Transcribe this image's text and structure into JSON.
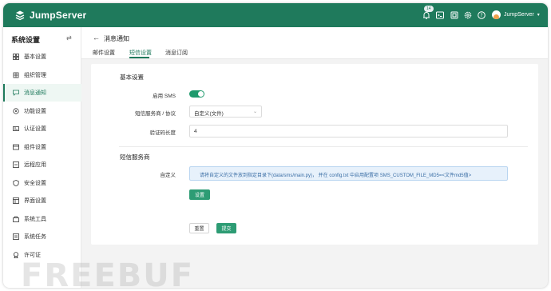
{
  "header": {
    "brand": "JumpServer",
    "notification_count": "14",
    "user_name": "JumpServer",
    "colors": {
      "bar": "#1f7a5c",
      "accent": "#2d9c74"
    }
  },
  "sidebar": {
    "title": "系统设置",
    "items": [
      {
        "label": "基本设置",
        "icon": "grid-icon"
      },
      {
        "label": "组织管理",
        "icon": "org-icon"
      },
      {
        "label": "消息通知",
        "icon": "message-icon",
        "active": true
      },
      {
        "label": "功能设置",
        "icon": "function-icon"
      },
      {
        "label": "认证设置",
        "icon": "auth-icon"
      },
      {
        "label": "组件设置",
        "icon": "component-icon"
      },
      {
        "label": "远程应用",
        "icon": "remote-app-icon"
      },
      {
        "label": "安全设置",
        "icon": "shield-icon"
      },
      {
        "label": "界面设置",
        "icon": "interface-icon"
      },
      {
        "label": "系统工具",
        "icon": "toolbox-icon"
      },
      {
        "label": "系统任务",
        "icon": "task-icon"
      },
      {
        "label": "许可证",
        "icon": "license-icon"
      }
    ]
  },
  "page": {
    "title": "消息通知",
    "tabs": [
      "邮件设置",
      "短信设置",
      "消息订阅"
    ],
    "active_tab": "短信设置"
  },
  "form": {
    "section_basic": "基本设置",
    "enable_sms_label": "启用 SMS",
    "enable_sms": true,
    "provider_label": "短信服务商 / 协议",
    "provider_value": "自定义(文件)",
    "code_length_label": "验证码长度",
    "code_length_value": "4",
    "section_provider": "短信服务商",
    "custom_label": "自定义",
    "custom_help": "请将自定义的文件放到指定目录下(data/sms/main.py)， 并在 config.txt 中启用配置项 SMS_CUSTOM_FILE_MD5=<文件md5值>",
    "settings_button": "设置",
    "reset_button": "重置",
    "submit_button": "提交"
  },
  "watermark": "FREEBUF"
}
